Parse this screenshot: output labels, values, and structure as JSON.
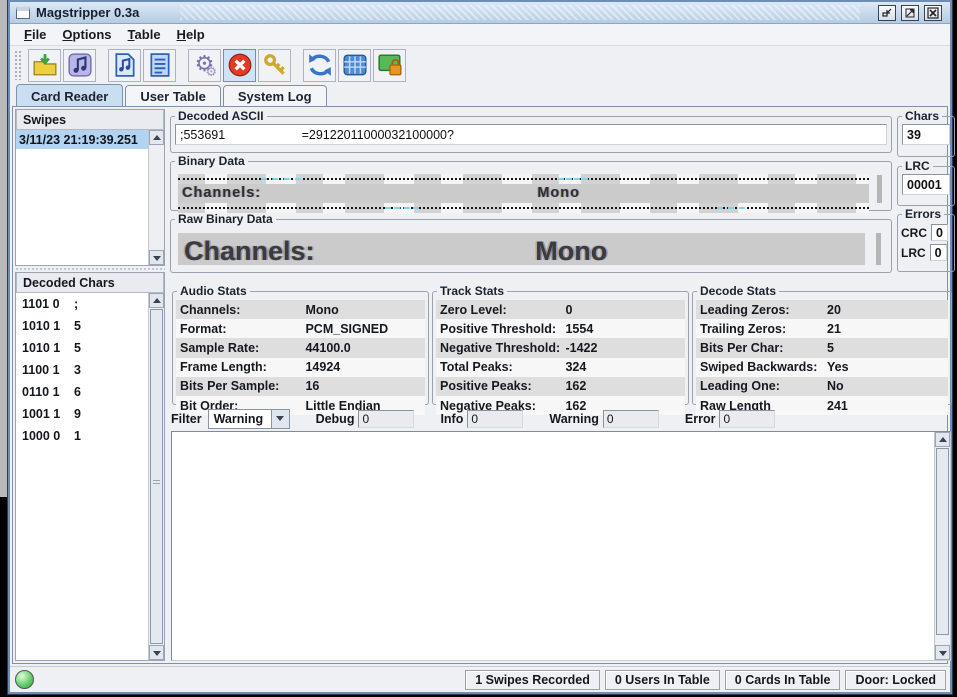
{
  "window": {
    "title": "Magstripper 0.3a"
  },
  "menu": {
    "items": [
      "File",
      "Options",
      "Table",
      "Help"
    ]
  },
  "toolbar": {
    "icons": [
      "open-file",
      "save-audio",
      "audio-file",
      "text-log",
      "settings-gears",
      "stop",
      "key",
      "refresh",
      "table",
      "door-lock"
    ]
  },
  "tabs": {
    "items": [
      "Card Reader",
      "User Table",
      "System Log"
    ],
    "selected": "Card Reader"
  },
  "swipes": {
    "header": "Swipes",
    "rows": [
      "3/11/23 21:19:39.251"
    ]
  },
  "decoded_chars": {
    "header": "Decoded Chars",
    "rows": [
      {
        "bits": "1101 0",
        "char": ";"
      },
      {
        "bits": "1010 1",
        "char": "5"
      },
      {
        "bits": "1010 1",
        "char": "5"
      },
      {
        "bits": "1100 1",
        "char": "3"
      },
      {
        "bits": "0110 1",
        "char": "6"
      },
      {
        "bits": "1001 1",
        "char": "9"
      },
      {
        "bits": "1000 0",
        "char": "1"
      }
    ]
  },
  "decoded_ascii": {
    "title": "Decoded ASCII",
    "value": ";553691                      =29122011000032100000?"
  },
  "binary_data": {
    "title": "Binary Data",
    "overlay_label": "Channels:",
    "overlay_value": "Mono"
  },
  "raw_binary_data": {
    "title": "Raw Binary Data",
    "overlay_label": "Channels:",
    "overlay_value": "Mono"
  },
  "chars": {
    "title": "Chars",
    "value": "39"
  },
  "lrc": {
    "title": "LRC",
    "value": "00001"
  },
  "errors": {
    "title": "Errors",
    "rows": [
      {
        "label": "CRC",
        "value": "0"
      },
      {
        "label": "LRC",
        "value": "0"
      }
    ]
  },
  "audio_stats": {
    "title": "Audio Stats",
    "rows": [
      {
        "label": "Channels:",
        "value": "Mono"
      },
      {
        "label": "Format:",
        "value": "PCM_SIGNED"
      },
      {
        "label": "Sample Rate:",
        "value": "44100.0"
      },
      {
        "label": "Frame Length:",
        "value": "14924"
      },
      {
        "label": "Bits Per Sample:",
        "value": "16"
      },
      {
        "label": "Bit Order:",
        "value": "Little Endian"
      }
    ]
  },
  "track_stats": {
    "title": "Track Stats",
    "rows": [
      {
        "label": "Zero Level:",
        "value": "0"
      },
      {
        "label": "Positive Threshold:",
        "value": "1554"
      },
      {
        "label": "Negative Threshold:",
        "value": "-1422"
      },
      {
        "label": "Total Peaks:",
        "value": "324"
      },
      {
        "label": "Positive Peaks:",
        "value": "162"
      },
      {
        "label": "Negative Peaks:",
        "value": "162"
      }
    ]
  },
  "decode_stats": {
    "title": "Decode Stats",
    "rows": [
      {
        "label": "Leading Zeros:",
        "value": "20"
      },
      {
        "label": "Trailing Zeros:",
        "value": "21"
      },
      {
        "label": "Bits Per Char:",
        "value": "5"
      },
      {
        "label": "Swiped Backwards:",
        "value": "Yes"
      },
      {
        "label": "Leading One:",
        "value": "No"
      },
      {
        "label": "Raw Length",
        "value": "241"
      }
    ]
  },
  "filter": {
    "label": "Filter",
    "selected": "Warning",
    "counters": [
      {
        "label": "Debug",
        "value": "0"
      },
      {
        "label": "Info",
        "value": "0"
      },
      {
        "label": "Warning",
        "value": "0"
      },
      {
        "label": "Error",
        "value": "0"
      }
    ]
  },
  "status_bar": {
    "items": [
      "1 Swipes Recorded",
      "0 Users In Table",
      "0 Cards In Table",
      "Door: Locked"
    ]
  }
}
